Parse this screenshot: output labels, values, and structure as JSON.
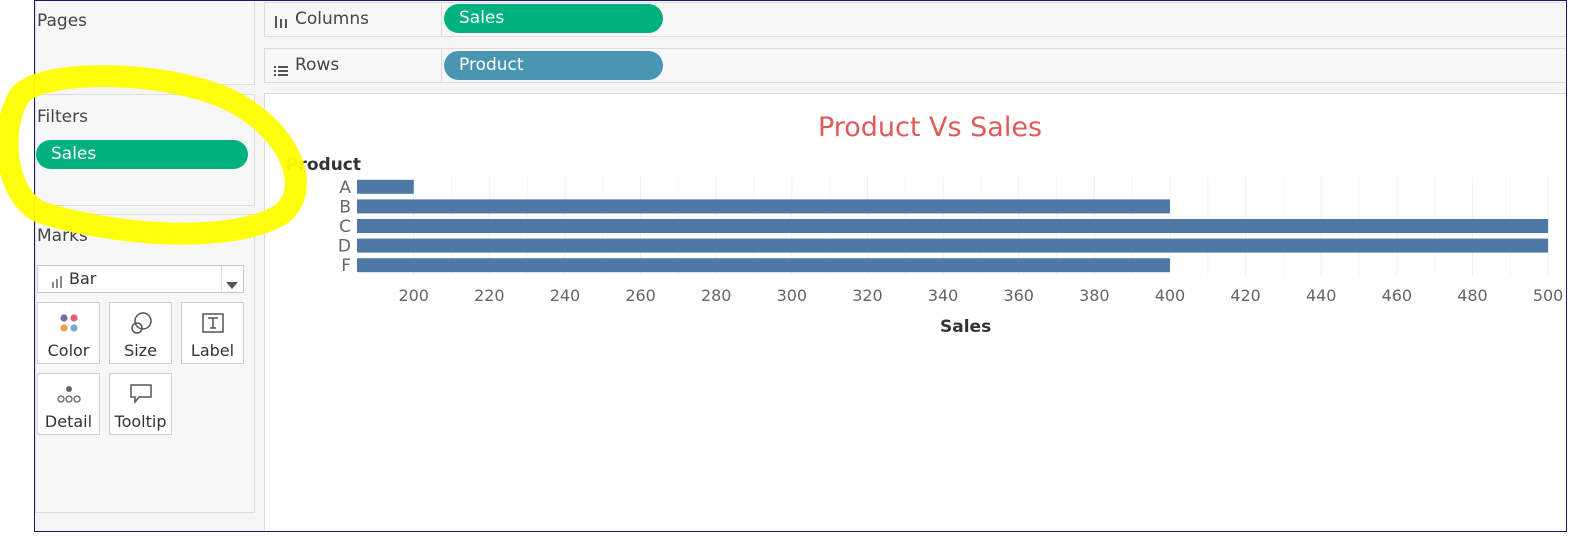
{
  "left": {
    "pages_title": "Pages",
    "filters_title": "Filters",
    "filter_pill": "Sales",
    "marks_title": "Marks",
    "mark_type": "Bar",
    "mark_buttons": [
      "Color",
      "Size",
      "Label",
      "Detail",
      "Tooltip"
    ]
  },
  "shelves": {
    "columns_label": "Columns",
    "columns_pill": "Sales",
    "rows_label": "Rows",
    "rows_pill": "Product"
  },
  "colors": {
    "bar": "#4e79a7",
    "title": "#e05a5a",
    "measure_pill": "#00b180",
    "dimension_pill": "#4996b2",
    "highlight": "#ffff00"
  },
  "chart_data": {
    "type": "bar",
    "orientation": "horizontal",
    "title": "Product Vs Sales",
    "ylabel": "Product",
    "xlabel": "Sales",
    "categories": [
      "A",
      "B",
      "C",
      "D",
      "F"
    ],
    "values": [
      200,
      400,
      500,
      500,
      400
    ],
    "xlim": [
      185,
      505
    ],
    "xticks": [
      200,
      220,
      240,
      260,
      280,
      300,
      320,
      340,
      360,
      380,
      400,
      420,
      440,
      460,
      480,
      500
    ],
    "grid": true
  }
}
